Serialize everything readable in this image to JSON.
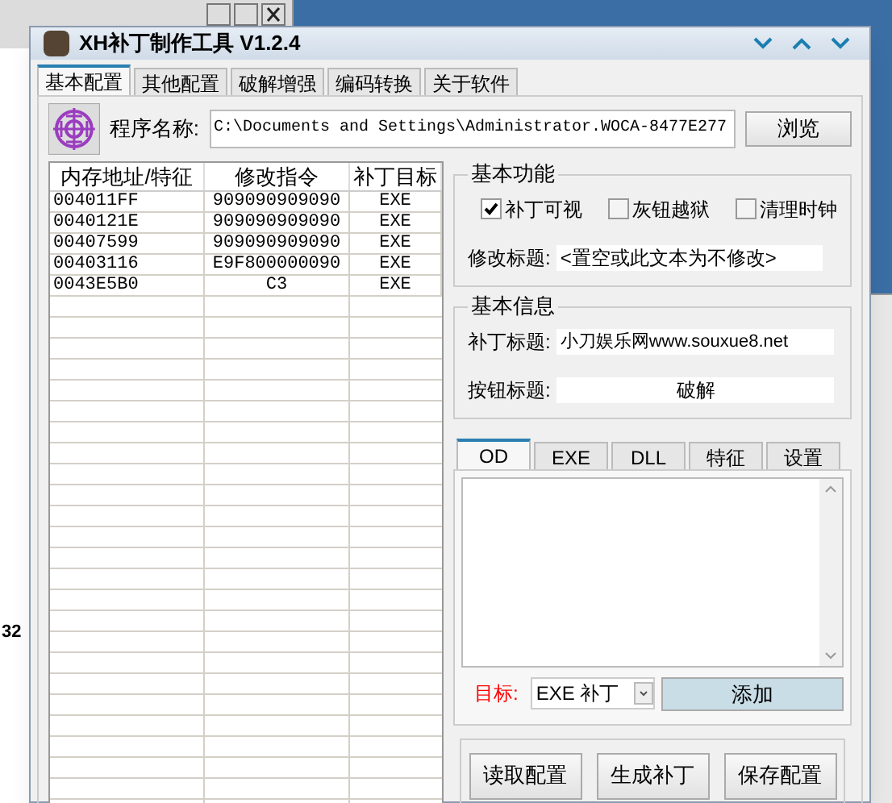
{
  "background": {
    "texts": [
      "32"
    ]
  },
  "window": {
    "title": "XH补丁制作工具 V1.2.4"
  },
  "tabs": [
    {
      "label": "基本配置",
      "selected": true
    },
    {
      "label": "其他配置",
      "selected": false
    },
    {
      "label": "破解增强",
      "selected": false
    },
    {
      "label": "编码转换",
      "selected": false
    },
    {
      "label": "关于软件",
      "selected": false
    }
  ],
  "program": {
    "label": "程序名称:",
    "value": "C:\\Documents and Settings\\Administrator.WOCA-8477E277",
    "browse_button": "浏览"
  },
  "table": {
    "columns": [
      "内存地址/特征",
      "修改指令",
      "补丁目标"
    ],
    "rows": [
      [
        "004011FF",
        "909090909090",
        "EXE"
      ],
      [
        "0040121E",
        "909090909090",
        "EXE"
      ],
      [
        "00407599",
        "909090909090",
        "EXE"
      ],
      [
        "00403116",
        "E9F800000090",
        "EXE"
      ],
      [
        "0043E5B0",
        "C3",
        "EXE"
      ]
    ]
  },
  "basic_functions": {
    "title": "基本功能",
    "checkboxes": [
      {
        "label": "补丁可视",
        "checked": true
      },
      {
        "label": "灰钮越狱",
        "checked": false
      },
      {
        "label": "清理时钟",
        "checked": false
      }
    ],
    "modify_title": {
      "label": "修改标题:",
      "value": "<置空或此文本为不修改>"
    }
  },
  "basic_info": {
    "title": "基本信息",
    "patch_title": {
      "label": "补丁标题:",
      "value": "小刀娱乐网www.souxue8.net"
    },
    "button_title": {
      "label": "按钮标题:",
      "value": "破解"
    }
  },
  "patch_tabs": [
    {
      "label": "OD",
      "selected": true
    },
    {
      "label": "EXE",
      "selected": false
    },
    {
      "label": "DLL",
      "selected": false
    },
    {
      "label": "特征",
      "selected": false
    },
    {
      "label": "设置",
      "selected": false
    }
  ],
  "target": {
    "label": "目标:",
    "value": "EXE 补丁",
    "add_button": "添加"
  },
  "buttons": [
    "读取配置",
    "生成补丁",
    "保存配置"
  ]
}
